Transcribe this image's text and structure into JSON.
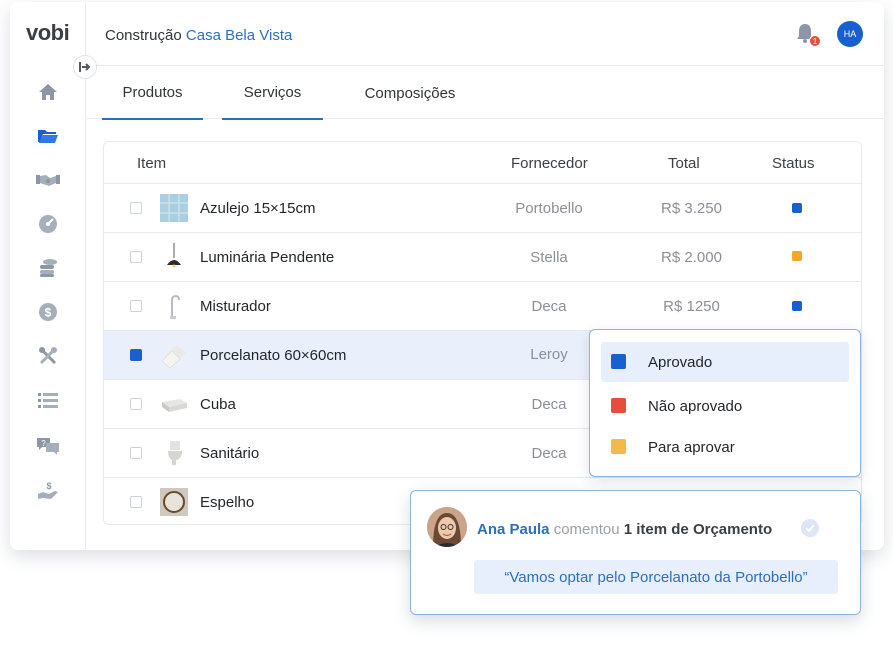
{
  "brand": {
    "logo": "vobi"
  },
  "header": {
    "breadcrumb_prefix": "Construção",
    "project_name": "Casa Bela Vista",
    "notification_count": "1",
    "user_initials": "HA"
  },
  "sidebar": {
    "items": [
      {
        "icon": "home-icon"
      },
      {
        "icon": "folder-icon"
      },
      {
        "icon": "handshake-icon"
      },
      {
        "icon": "gauge-icon"
      },
      {
        "icon": "coins-icon"
      },
      {
        "icon": "dollar-icon"
      },
      {
        "icon": "tools-icon"
      },
      {
        "icon": "list-icon"
      },
      {
        "icon": "chat-icon"
      },
      {
        "icon": "payment-icon"
      }
    ],
    "active_index": 1
  },
  "tabs": [
    {
      "label": "Produtos",
      "active": true
    },
    {
      "label": "Serviços",
      "active": true
    },
    {
      "label": "Composições",
      "active": false
    }
  ],
  "table": {
    "headers": {
      "item": "Item",
      "supplier": "Fornecedor",
      "total": "Total",
      "status": "Status"
    },
    "rows": [
      {
        "name": "Azulejo 15×15cm",
        "supplier": "Portobello",
        "total": "R$ 3.250",
        "status": "Aprovado",
        "checked": false
      },
      {
        "name": "Luminária Pendente",
        "supplier": "Stella",
        "total": "R$ 2.000",
        "status": "Para aprovar",
        "checked": false
      },
      {
        "name": "Misturador",
        "supplier": "Deca",
        "total": "R$ 1250",
        "status": "Aprovado",
        "checked": false
      },
      {
        "name": "Porcelanato 60×60cm",
        "supplier": "Leroy",
        "total": "",
        "status": "",
        "checked": true
      },
      {
        "name": "Cuba",
        "supplier": "Deca",
        "total": "",
        "status": "",
        "checked": false
      },
      {
        "name": "Sanitário",
        "supplier": "Deca",
        "total": "",
        "status": "",
        "checked": false
      },
      {
        "name": "Espelho",
        "supplier": "",
        "total": "",
        "status": "",
        "checked": false
      }
    ]
  },
  "status_dropdown": {
    "options": [
      {
        "label": "Aprovado",
        "color": "#1a5fd0",
        "highlighted": true
      },
      {
        "label": "Não aprovado",
        "color": "#e74c3c",
        "highlighted": false
      },
      {
        "label": "Para aprovar",
        "color": "#f5b94a",
        "highlighted": false
      }
    ]
  },
  "comment": {
    "author": "Ana Paula",
    "verb": "comentou",
    "subject": "1 item de Orçamento",
    "text": "“Vamos optar pelo Porcelanato da Portobello”"
  },
  "colors": {
    "accent": "#1a5fd0",
    "link": "#2d6fb8",
    "approved": "#1a5fd0",
    "pending": "#f5a623",
    "rejected": "#e74c3c"
  }
}
